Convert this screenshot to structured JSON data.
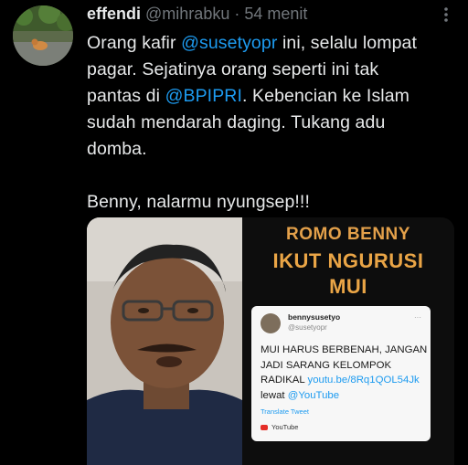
{
  "tweet": {
    "display_name": "effendi",
    "handle": "@mihrabku",
    "separator": "·",
    "time": "54 menit",
    "lines": [
      [
        {
          "t": "Orang kafir "
        },
        {
          "t": "@susetyopr",
          "link": true
        },
        {
          "t": " ini, selalu lompat"
        }
      ],
      [
        {
          "t": "pagar. Sejatinya orang seperti ini tak"
        }
      ],
      [
        {
          "t": "pantas di "
        },
        {
          "t": "@BPIPRI",
          "link": true
        },
        {
          "t": ". Kebencian ke Islam"
        }
      ],
      [
        {
          "t": "sudah mendarah daging. Tukang adu"
        }
      ],
      [
        {
          "t": "domba."
        }
      ],
      [],
      [
        {
          "t": "Benny, nalarmu nyungsep!!!"
        }
      ]
    ]
  },
  "media": {
    "headline": [
      "ROMO BENNY",
      "IKUT NGURUSI",
      "MUI"
    ],
    "embedded": {
      "name": "bennysusetyo",
      "handle": "@susetyopr",
      "lines": [
        [
          {
            "t": "MUI HARUS BERBENAH, JANGAN"
          }
        ],
        [
          {
            "t": "JADI SARANG KELOMPOK"
          }
        ],
        [
          {
            "t": "RADIKAL "
          },
          {
            "t": "youtu.be/8Rq1QOL54Jk",
            "link": true
          }
        ],
        [
          {
            "t": "lewat "
          },
          {
            "t": "@YouTube",
            "link": true
          }
        ]
      ],
      "translate": "Translate Tweet",
      "source": "YouTube"
    }
  },
  "colors": {
    "link": "#1d9bf0",
    "headline": "#e6a84b",
    "background": "#000000",
    "text": "#e7e9ea"
  }
}
